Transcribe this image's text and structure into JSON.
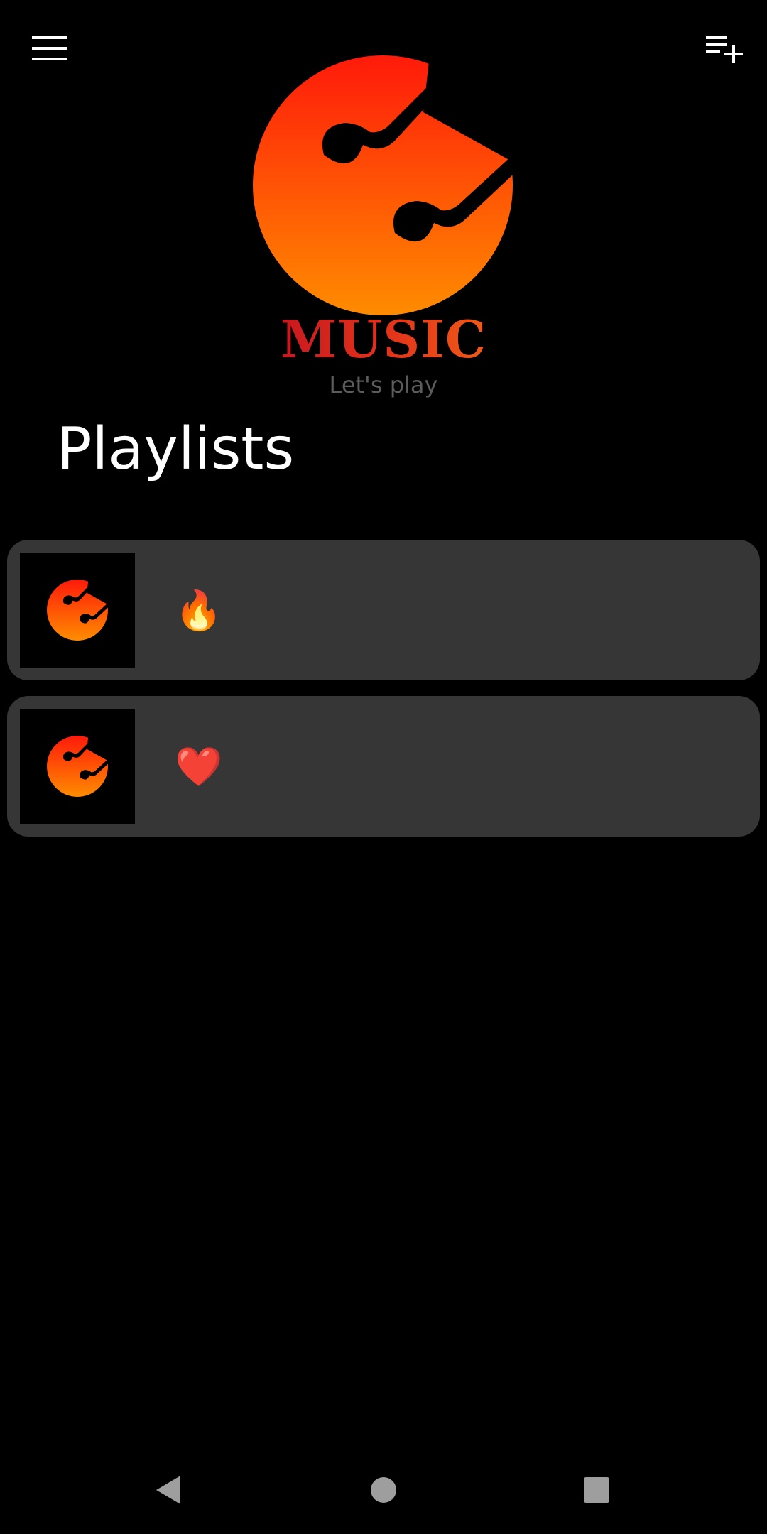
{
  "app": {
    "logo_text": "MUSIC",
    "tagline": "Let's play",
    "brand_colors": {
      "gradient_top": "#ff1a0a",
      "gradient_bottom": "#ff8c00",
      "wordmark": "#e2321b"
    }
  },
  "toolbar": {
    "menu_icon": "hamburger-menu-icon",
    "add_playlist_icon": "playlist-add-icon"
  },
  "section": {
    "title": "Playlists"
  },
  "playlists": [
    {
      "name": "🔥",
      "thumbnail_icon": "music-logo-icon"
    },
    {
      "name": "❤️",
      "thumbnail_icon": "music-logo-icon"
    }
  ],
  "navigation": {
    "back_icon": "back-triangle-icon",
    "home_icon": "home-circle-icon",
    "recents_icon": "recents-square-icon"
  },
  "colors": {
    "background": "#000000",
    "card": "#363636",
    "tagline": "#5c5c5c",
    "nav_icons": "#9e9e9e"
  }
}
